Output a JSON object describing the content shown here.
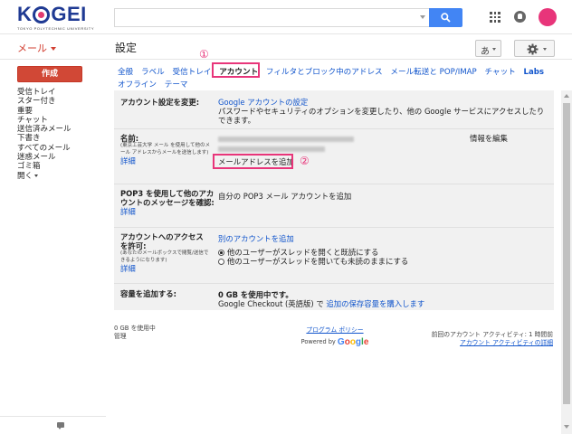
{
  "header": {
    "logo_text_1": "K",
    "logo_text_2": "GEI",
    "logo_sub": "TOKYO POLYTECHNIC UNIVERSITY",
    "search_placeholder": ""
  },
  "subheader": {
    "mail_menu": "メール",
    "page_title": "設定",
    "lang_button": "あ"
  },
  "sidebar": {
    "compose": "作成",
    "items": [
      "受信トレイ",
      "スター付き",
      "重要",
      "チャット",
      "送信済みメール",
      "下書き",
      "すべてのメール",
      "迷惑メール",
      "ゴミ箱"
    ],
    "more": "開く"
  },
  "tabs": {
    "row1": [
      "全般",
      "ラベル",
      "受信トレイ",
      "アカウント",
      "フィルタとブロック中のアドレス",
      "メール転送と POP/IMAP",
      "チャット",
      "Labs"
    ],
    "row2": [
      "オフライン",
      "テーマ"
    ]
  },
  "markers": {
    "one": "①",
    "two": "②"
  },
  "settings": {
    "account_change": {
      "label": "アカウント設定を変更:",
      "link": "Google アカウントの設定",
      "desc": "パスワードやセキュリティのオプションを変更したり、他の Google サービスにアクセスしたりできます。"
    },
    "name": {
      "label": "名前:",
      "note": "(東京工芸大学 メール を使用して他のメール アドレスからメールを送信します)",
      "detail": "詳細",
      "edit": "情報を編集",
      "add_address": "メールアドレスを追加"
    },
    "pop3": {
      "label": "POP3 を使用して他のアカウントのメッセージを確認:",
      "detail": "詳細",
      "link": "自分の POP3 メール アカウントを追加"
    },
    "access": {
      "label": "アカウントへのアクセスを許可:",
      "note": "(あなたのメールボックスで閲覧/送信できるようになります)",
      "detail": "詳細",
      "link": "別のアカウントを追加",
      "opt1": "他のユーザーがスレッドを開くと既読にする",
      "opt2": "他のユーザーがスレッドを開いても未読のままにする"
    },
    "storage": {
      "label": "容量を追加する:",
      "usage": "0 GB を使用中です。",
      "checkout": "Google Checkout (英語版) で ",
      "buy_link": "追加の保存容量を購入します"
    }
  },
  "footer": {
    "usage": "0 GB を使用中",
    "manage": "管理",
    "policy": "プログラム ポリシー",
    "powered": "Powered by ",
    "google": "Google",
    "last_activity": "前回のアカウント アクティビティ: 1 時間前",
    "activity_detail": "アカウント アクティビティの詳細"
  }
}
